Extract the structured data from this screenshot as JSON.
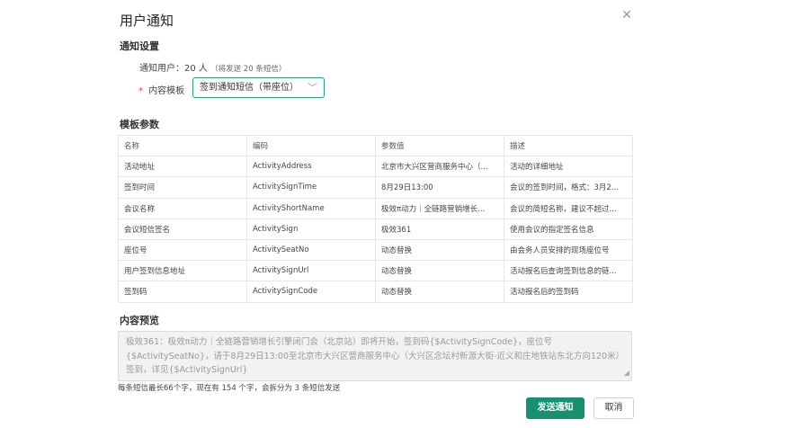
{
  "dialog": {
    "title": "用户通知",
    "close_icon": "close-icon"
  },
  "settings": {
    "section_title": "通知设置",
    "notify_users_label": "通知用户：20 人",
    "notify_users_hint": "（将发送 20 条短信）",
    "required_mark": "*",
    "template_label": "内容模板",
    "template_selected": "签到通知短信（带座位）"
  },
  "params": {
    "section_title": "模板参数",
    "headers": [
      "名称",
      "编码",
      "参数值",
      "描述"
    ],
    "rows": [
      [
        "活动地址",
        "ActivityAddress",
        "北京市大兴区营商服务中心（...",
        "活动的详细地址"
      ],
      [
        "签到时间",
        "ActivitySignTime",
        "8月29日13:00",
        "会议的签到时间，格式：3月2..."
      ],
      [
        "会议名称",
        "ActivityShortName",
        "极效π动力｜全链路营销增长...",
        "会议的简短名称，建议不超过..."
      ],
      [
        "会议短信签名",
        "ActivitySign",
        "极效361",
        "使用会议的指定签名信息"
      ],
      [
        "座位号",
        "ActivitySeatNo",
        "动态替换",
        "由会务人员安排的现场座位号"
      ],
      [
        "用户签到信息地址",
        "ActivitySignUrl",
        "动态替换",
        "活动报名后查询签到信息的链..."
      ],
      [
        "签到码",
        "ActivitySignCode",
        "动态替换",
        "活动报名后的签到码"
      ]
    ]
  },
  "preview": {
    "section_title": "内容预览",
    "text": "极效361：极效π动力｜全链路营销增长引擎闭门会（北京站）即将开始，签到码{$ActivitySignCode}，座位号{$ActivitySeatNo}，请于8月29日13:00至北京市大兴区营商服务中心（大兴区念坛村新源大街-近义和庄地铁站东北方向120米）签到，详见{$ActivitySignUrl}",
    "sms_note": "每条短信最长66个字，现在有 154 个字，会拆分为 3 条短信发送"
  },
  "actions": {
    "send_label": "发送通知",
    "cancel_label": "取消"
  },
  "colors": {
    "accent": "#198f6f",
    "select_border": "#2e9b82",
    "required": "#e4393c"
  }
}
